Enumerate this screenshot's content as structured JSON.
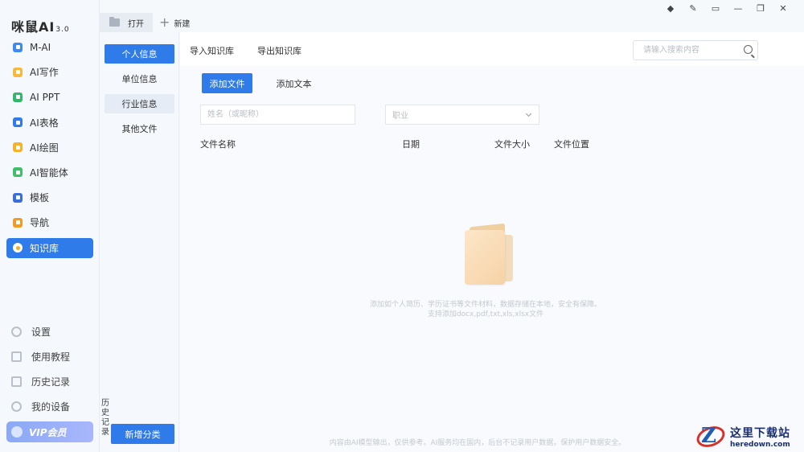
{
  "app": {
    "logo": "咪鼠AI",
    "version": "3.0"
  },
  "sidebar": {
    "items": [
      {
        "label": "M-AI",
        "icon": "m-ai-icon",
        "color": "#3d8bf2"
      },
      {
        "label": "AI写作",
        "icon": "writing-icon",
        "color": "#f6b93b"
      },
      {
        "label": "AI PPT",
        "icon": "ppt-icon",
        "color": "#33b86b"
      },
      {
        "label": "AI表格",
        "icon": "table-icon",
        "color": "#2f7bea"
      },
      {
        "label": "AI绘图",
        "icon": "drawing-icon",
        "color": "#f6b22a"
      },
      {
        "label": "AI智能体",
        "icon": "agent-icon",
        "color": "#3fbf6a"
      },
      {
        "label": "模板",
        "icon": "template-icon",
        "color": "#3b6fd8"
      },
      {
        "label": "导航",
        "icon": "navigation-icon",
        "color": "#f39c24"
      },
      {
        "label": "知识库",
        "icon": "knowledge-base-icon",
        "color": "#f2b01e",
        "active": true
      }
    ],
    "bottom": [
      {
        "label": "设置",
        "icon": "gear-icon"
      },
      {
        "label": "使用教程",
        "icon": "tutorial-icon"
      },
      {
        "label": "历史记录",
        "icon": "history-icon"
      },
      {
        "label": "我的设备",
        "icon": "device-icon"
      }
    ],
    "vip": "VIP会员"
  },
  "toolbar": {
    "open": "打开",
    "new": "新建"
  },
  "categories": {
    "items": [
      "个人信息",
      "单位信息",
      "行业信息",
      "其他文件"
    ],
    "active": "个人信息",
    "history": "历史记录",
    "add_button": "新增分类"
  },
  "main": {
    "import": "导入知识库",
    "export": "导出知识库",
    "search_placeholder": "请输入搜索内容",
    "add_file": "添加文件",
    "add_text": "添加文本",
    "name_placeholder": "姓名（或昵称）",
    "job_placeholder": "职业",
    "columns": [
      "文件名称",
      "日期",
      "文件大小",
      "文件位置"
    ],
    "empty_line1": "添加如个人简历、学历证书等文件材料，数据存储在本地，安全有保障。",
    "empty_line2": "支持添加docx,pdf,txt,xls,xlsx文件",
    "footer": "内容由AI模型输出，仅供参考。AI服务均在国内，后台不记录用户数据，保护用户数据安全。"
  },
  "watermark": {
    "cn": "这里下载站",
    "en": "heredown.com"
  },
  "accent": "#2f7bea"
}
